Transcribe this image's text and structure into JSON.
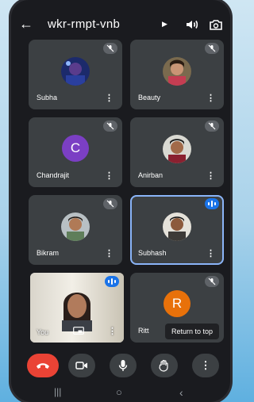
{
  "meeting": {
    "code": "wkr-rmpt-vnb"
  },
  "participants": [
    {
      "name": "Subha"
    },
    {
      "name": "Beauty"
    },
    {
      "name": "Chandrajit",
      "initial": "C",
      "color": "#7b3fc4"
    },
    {
      "name": "Anirban"
    },
    {
      "name": "Bikram"
    },
    {
      "name": "Subhash"
    },
    {
      "name": "You"
    },
    {
      "name": "Ritt",
      "initial": "R",
      "color": "#e8710a"
    }
  ],
  "toast": {
    "label": "Return to top"
  },
  "icons": {
    "back": "arrow-left-icon",
    "speaker": "speaker-icon",
    "flip": "camera-flip-icon",
    "mute": "mic-off-icon",
    "speaking": "audio-level-icon",
    "end": "call-end-icon",
    "camera": "videocam-icon",
    "mic": "mic-icon",
    "hand": "raise-hand-icon",
    "more": "more-vert-icon"
  },
  "colors": {
    "tile": "#3c4043",
    "end_call": "#ea4335",
    "active_outline": "#8ab4f8"
  }
}
